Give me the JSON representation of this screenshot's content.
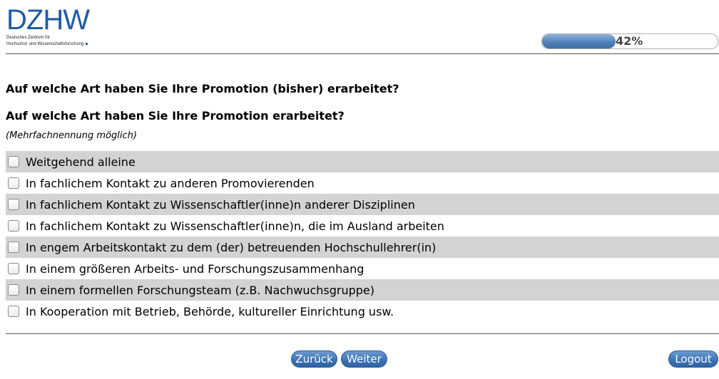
{
  "logo": {
    "mark": "DZHW",
    "line1": "Deutsches Zentrum für",
    "line2": "Hochschul- und Wissenschaftsforschung"
  },
  "progress": {
    "value": 0.42,
    "label": "42%"
  },
  "question": {
    "title": "Auf welche Art haben Sie Ihre Promotion (bisher) erarbeitet?",
    "subtitle": "Auf welche Art haben Sie Ihre Promotion erarbeitet?",
    "hint": "(Mehrfachnennung möglich)"
  },
  "options": [
    {
      "label": "Weitgehend alleine",
      "checked": false
    },
    {
      "label": "In fachlichem Kontakt zu anderen Promovierenden",
      "checked": false
    },
    {
      "label": "In fachlichem Kontakt zu Wissenschaftler(inne)n anderer Disziplinen",
      "checked": false
    },
    {
      "label": "In fachlichem Kontakt zu Wissenschaftler(inne)n, die im Ausland arbeiten",
      "checked": false
    },
    {
      "label": "In engem Arbeitskontakt zu dem (der) betreuenden Hochschullehrer(in)",
      "checked": false
    },
    {
      "label": "In einem größeren Arbeits- und Forschungszusammenhang",
      "checked": false
    },
    {
      "label": "In einem formellen Forschungsteam (z.B. Nachwuchsgruppe)",
      "checked": false
    },
    {
      "label": "In Kooperation mit Betrieb, Behörde, kultureller Einrichtung usw.",
      "checked": false
    }
  ],
  "buttons": {
    "back": "Zurück",
    "next": "Weiter",
    "logout": "Logout"
  },
  "colors": {
    "brand": "#1f5ba6",
    "row_shade": "#d3d3d3",
    "button": "#3f74b5"
  }
}
